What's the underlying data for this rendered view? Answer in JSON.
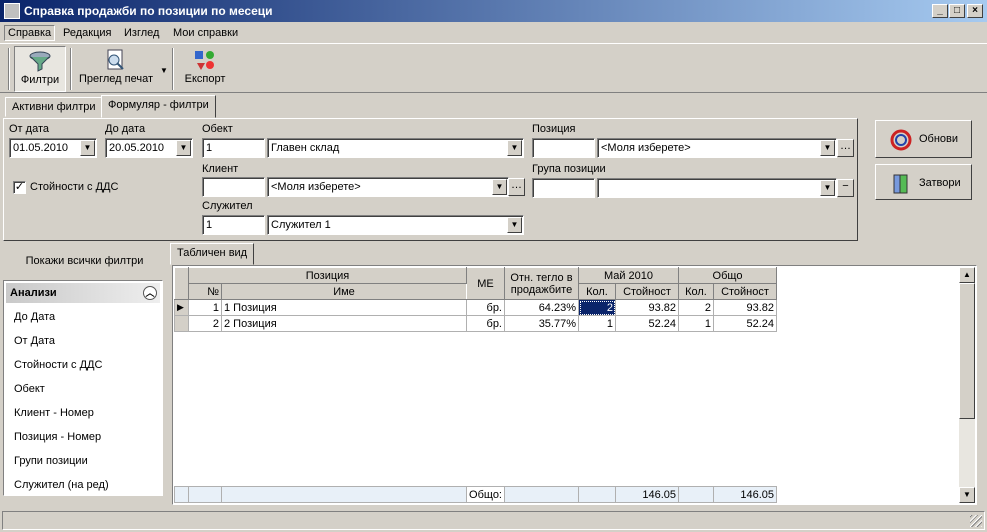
{
  "window": {
    "title": "Справка продажби по позиции по месеци"
  },
  "menu": [
    "Справка",
    "Редакция",
    "Изглед",
    "Мои справки"
  ],
  "toolbar": {
    "filters": "Филтри",
    "preview": "Преглед печат",
    "export": "Експорт"
  },
  "tabs": [
    "Активни филтри",
    "Формуляр - филтри"
  ],
  "filters": {
    "from_date_label": "От дата",
    "from_date": "01.05.2010",
    "to_date_label": "До дата",
    "to_date": "20.05.2010",
    "vat_label": "Стойности с ДДС",
    "vat_checked": "✓",
    "object_label": "Обект",
    "object_code": "1",
    "object_name": "Главен склад",
    "client_label": "Клиент",
    "client_code": "",
    "client_name": "<Моля изберете>",
    "employee_label": "Служител",
    "employee_code": "1",
    "employee_name": "Служител 1",
    "position_label": "Позиция",
    "position_code": "",
    "position_name": "<Моля изберете>",
    "group_label": "Група позиции",
    "group_code": "",
    "group_name": ""
  },
  "buttons": {
    "refresh": "Обнови",
    "close": "Затвори"
  },
  "left": {
    "show_all": "Покажи всички филтри",
    "analyses_header": "Анализи",
    "items": [
      "До Дата",
      "От Дата",
      "Стойности с ДДС",
      "Обект",
      "Клиент - Номер",
      "Позиция - Номер",
      "Групи позиции",
      "Служител (на ред)"
    ]
  },
  "grid": {
    "tab": "Табличен вид",
    "headers": {
      "position": "Позиция",
      "no": "№",
      "name": "Име",
      "unit": "МЕ",
      "rel_weight": "Отн. тегло в продажбите",
      "may": "Май 2010",
      "total": "Общо",
      "qty": "Кол.",
      "value": "Стойност"
    },
    "rows": [
      {
        "no": "1",
        "name": "1 Позиция",
        "unit": "бр.",
        "weight": "64.23%",
        "may_qty": "2",
        "may_value": "93.82",
        "tot_qty": "2",
        "tot_value": "93.82"
      },
      {
        "no": "2",
        "name": "2 Позиция",
        "unit": "бр.",
        "weight": "35.77%",
        "may_qty": "1",
        "may_value": "52.24",
        "tot_qty": "1",
        "tot_value": "52.24"
      }
    ],
    "footer": {
      "label": "Общо:",
      "may_value": "146.05",
      "tot_value": "146.05"
    }
  }
}
